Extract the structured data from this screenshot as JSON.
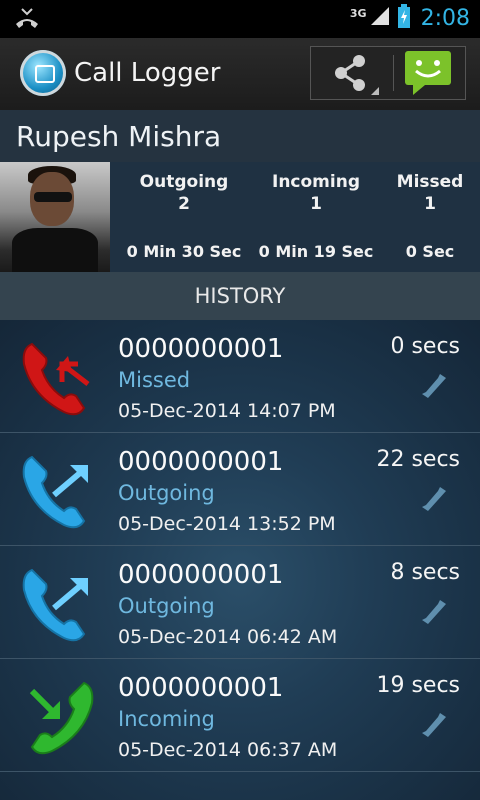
{
  "status_bar": {
    "network": "3G",
    "time": "2:08"
  },
  "action_bar": {
    "title": "Call Logger"
  },
  "contact": {
    "name": "Rupesh Mishra",
    "stats": [
      {
        "label": "Outgoing",
        "count": "2",
        "duration": "0 Min 30 Sec"
      },
      {
        "label": "Incoming",
        "count": "1",
        "duration": "0 Min 19 Sec"
      },
      {
        "label": "Missed",
        "count": "1",
        "duration": "0 Sec"
      }
    ]
  },
  "history": {
    "header": "HISTORY",
    "items": [
      {
        "number": "0000000001",
        "type": "Missed",
        "datetime": "05-Dec-2014 14:07 PM",
        "duration": "0 secs"
      },
      {
        "number": "0000000001",
        "type": "Outgoing",
        "datetime": "05-Dec-2014 13:52 PM",
        "duration": "22 secs"
      },
      {
        "number": "0000000001",
        "type": "Outgoing",
        "datetime": "05-Dec-2014 06:42 AM",
        "duration": "8 secs"
      },
      {
        "number": "0000000001",
        "type": "Incoming",
        "datetime": "05-Dec-2014 06:37 AM",
        "duration": "19 secs"
      }
    ]
  },
  "colors": {
    "accent": "#33b5e5",
    "missed": "#d01616",
    "outgoing": "#2aa6e6",
    "incoming": "#2fb82f",
    "type_text": "#6fb8df"
  },
  "icons": [
    "missed-call-icon",
    "outgoing-call-icon",
    "incoming-call-icon",
    "share-icon",
    "message-icon",
    "phone-handset-icon"
  ]
}
